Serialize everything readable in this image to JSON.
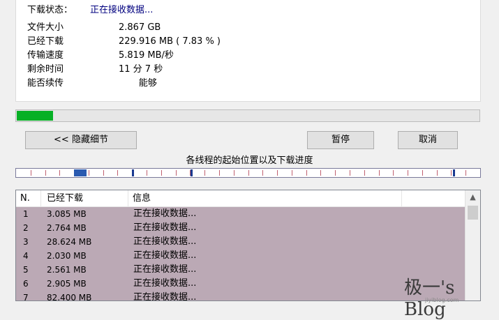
{
  "status": {
    "label": "下载状态：",
    "value": "正在接收数据..."
  },
  "details": [
    {
      "key": "文件大小",
      "value": "2.867  GB"
    },
    {
      "key": "已经下载",
      "value": "229.916  MB  ( 7.83 % )"
    },
    {
      "key": "传输速度",
      "value": "5.819  MB/秒"
    },
    {
      "key": "剩余时间",
      "value": "11 分 7 秒"
    },
    {
      "key": "能否续传",
      "value": "       能够"
    }
  ],
  "progress": {
    "percent": 7.83
  },
  "buttons": {
    "hide_details": "<< 隐藏细节",
    "pause": "暂停",
    "cancel": "取消"
  },
  "threads_title": "各线程的起始位置以及下载进度",
  "list": {
    "headers": [
      "N.",
      "已经下载",
      "信息"
    ],
    "rows": [
      {
        "n": "1",
        "downloaded": "3.085  MB",
        "info": "正在接收数据..."
      },
      {
        "n": "2",
        "downloaded": "2.764  MB",
        "info": "正在接收数据..."
      },
      {
        "n": "3",
        "downloaded": "28.624  MB",
        "info": "正在接收数据..."
      },
      {
        "n": "4",
        "downloaded": "2.030  MB",
        "info": "正在接收数据..."
      },
      {
        "n": "5",
        "downloaded": "2.561  MB",
        "info": "正在接收数据..."
      },
      {
        "n": "6",
        "downloaded": "2.905  MB",
        "info": "正在接收数据..."
      },
      {
        "n": "7",
        "downloaded": "82.400  MB",
        "info": "正在接收数据..."
      }
    ]
  },
  "watermark": {
    "text": "极一's Blog",
    "sub": "jiyiblog.com"
  },
  "colors": {
    "progress_fill": "#06b025",
    "status_value": "#00007f",
    "list_selected": "#bba9b5"
  }
}
